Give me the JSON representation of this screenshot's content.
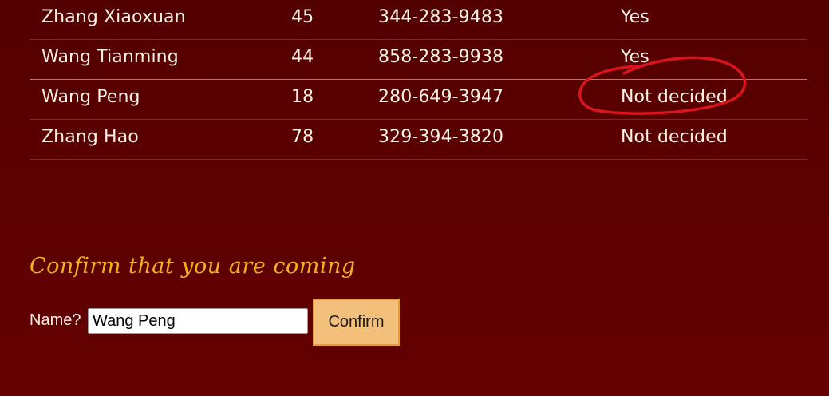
{
  "guests": [
    {
      "name": "Zhang Xiaoxuan",
      "age": "45",
      "phone": "344-283-9483",
      "rsvp": "Yes"
    },
    {
      "name": "Wang Tianming",
      "age": "44",
      "phone": "858-283-9938",
      "rsvp": "Yes"
    },
    {
      "name": "Wang Peng",
      "age": "18",
      "phone": "280-649-3947",
      "rsvp": "Not decided"
    },
    {
      "name": "Zhang Hao",
      "age": "78",
      "phone": "329-394-3820",
      "rsvp": "Not decided"
    }
  ],
  "confirm": {
    "heading": "Confirm that you are coming",
    "name_label": "Name?",
    "name_value": "Wang Peng",
    "button_label": "Confirm"
  },
  "colors": {
    "background": "#5c0000",
    "heading_accent": "#f0b21b",
    "button_fill": "#f2c07a",
    "button_border": "#e99a3a",
    "annotation": "#d9141a"
  }
}
